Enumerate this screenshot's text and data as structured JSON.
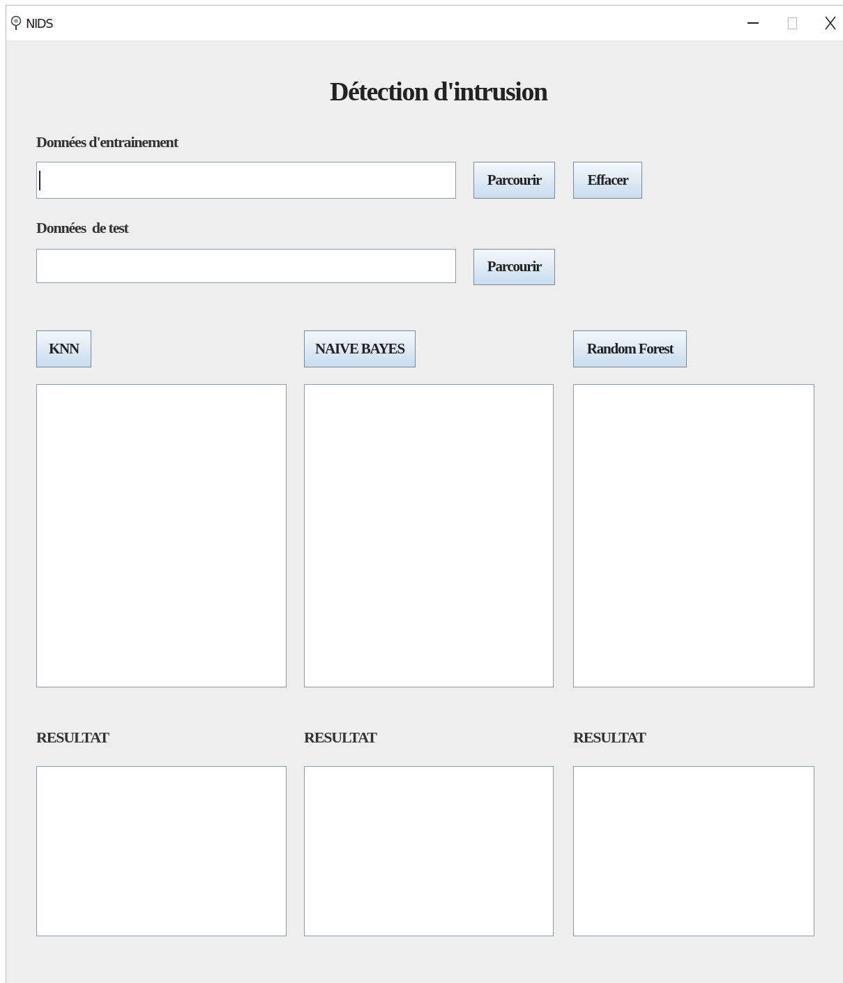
{
  "window": {
    "title": "NIDS"
  },
  "heading": "Détection d'intrusion",
  "training": {
    "label": "Données d'entrainement",
    "focused": true,
    "buttons": [
      "Parcourir",
      "Effacer"
    ]
  },
  "test": {
    "label": "Données  de test",
    "focused": false,
    "buttons": [
      "Parcourir"
    ]
  },
  "algorithms": [
    {
      "button": "KNN",
      "result_label": "RESULTAT"
    },
    {
      "button": "NAIVE BAYES",
      "result_label": "RESULTAT"
    },
    {
      "button": "Random Forest",
      "result_label": "RESULTAT"
    }
  ]
}
